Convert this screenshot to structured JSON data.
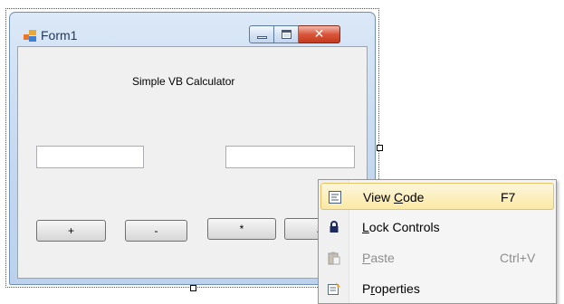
{
  "window": {
    "title": "Form1",
    "icon": "form-icon",
    "controls": {
      "minimize": "minimize-icon",
      "maximize": "maximize-icon",
      "close": "close-icon"
    }
  },
  "form": {
    "heading": "Simple VB Calculator",
    "buttons": [
      {
        "label": "+"
      },
      {
        "label": "-"
      },
      {
        "label": "*"
      },
      {
        "label": "/"
      }
    ]
  },
  "context_menu": {
    "items": [
      {
        "pre": "View ",
        "accel": "C",
        "post": "ode",
        "shortcut": "F7",
        "icon": "view-code-icon",
        "highlighted": true,
        "enabled": true
      },
      {
        "pre": "",
        "accel": "L",
        "post": "ock Controls",
        "shortcut": "",
        "icon": "lock-icon",
        "highlighted": false,
        "enabled": true
      },
      {
        "pre": "",
        "accel": "P",
        "post": "aste",
        "shortcut": "Ctrl+V",
        "icon": "paste-icon",
        "highlighted": false,
        "enabled": false
      },
      {
        "pre": "P",
        "accel": "r",
        "post": "operties",
        "shortcut": "",
        "icon": "properties-icon",
        "highlighted": false,
        "enabled": true
      }
    ]
  },
  "colors": {
    "titlebar": "#c3d7ee",
    "close_button": "#c43a1e",
    "menu_highlight": "#fbe9a4"
  }
}
